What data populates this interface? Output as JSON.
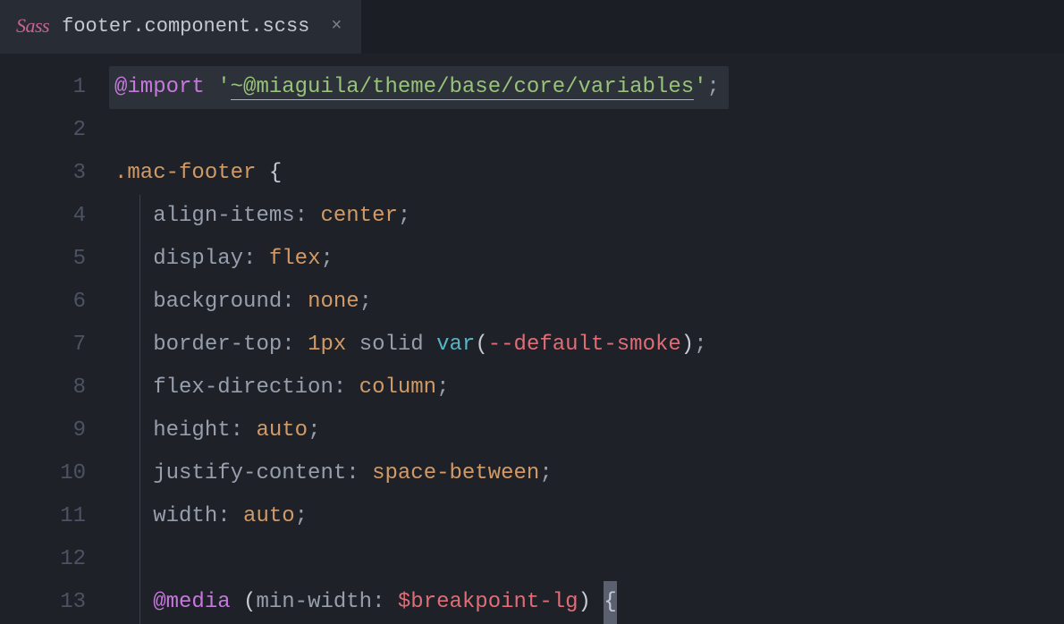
{
  "tab": {
    "lang_icon": "Sass",
    "filename": "footer.component.scss",
    "close_glyph": "×"
  },
  "gutter": [
    "1",
    "2",
    "3",
    "4",
    "5",
    "6",
    "7",
    "8",
    "9",
    "10",
    "11",
    "12",
    "13"
  ],
  "code": {
    "l1": {
      "kw": "@import",
      "sp": " ",
      "q1": "'",
      "path": "~@miaguila/theme/base/core/variables",
      "q2": "'",
      "semi": ";"
    },
    "l3": {
      "sel": ".mac-footer",
      "sp": " ",
      "brace": "{"
    },
    "l4": {
      "prop": "align-items",
      "colon": ":",
      "sp": " ",
      "val": "center",
      "semi": ";"
    },
    "l5": {
      "prop": "display",
      "colon": ":",
      "sp": " ",
      "val": "flex",
      "semi": ";"
    },
    "l6": {
      "prop": "background",
      "colon": ":",
      "sp": " ",
      "val": "none",
      "semi": ";"
    },
    "l7": {
      "prop": "border-top",
      "colon": ":",
      "sp": " ",
      "num": "1px",
      "sp2": " ",
      "solid": "solid",
      "sp3": " ",
      "fn": "var",
      "lp": "(",
      "arg": "--default-smoke",
      "rp": ")",
      "semi": ";"
    },
    "l8": {
      "prop": "flex-direction",
      "colon": ":",
      "sp": " ",
      "val": "column",
      "semi": ";"
    },
    "l9": {
      "prop": "height",
      "colon": ":",
      "sp": " ",
      "val": "auto",
      "semi": ";"
    },
    "l10": {
      "prop": "justify-content",
      "colon": ":",
      "sp": " ",
      "val": "space-between",
      "semi": ";"
    },
    "l11": {
      "prop": "width",
      "colon": ":",
      "sp": " ",
      "val": "auto",
      "semi": ";"
    },
    "l13": {
      "kw": "@media",
      "sp": " ",
      "lp": "(",
      "mprop": "min-width",
      "colon": ":",
      "sp2": " ",
      "var": "$breakpoint-lg",
      "rp": ")",
      "sp3": " ",
      "brace": "{"
    }
  }
}
